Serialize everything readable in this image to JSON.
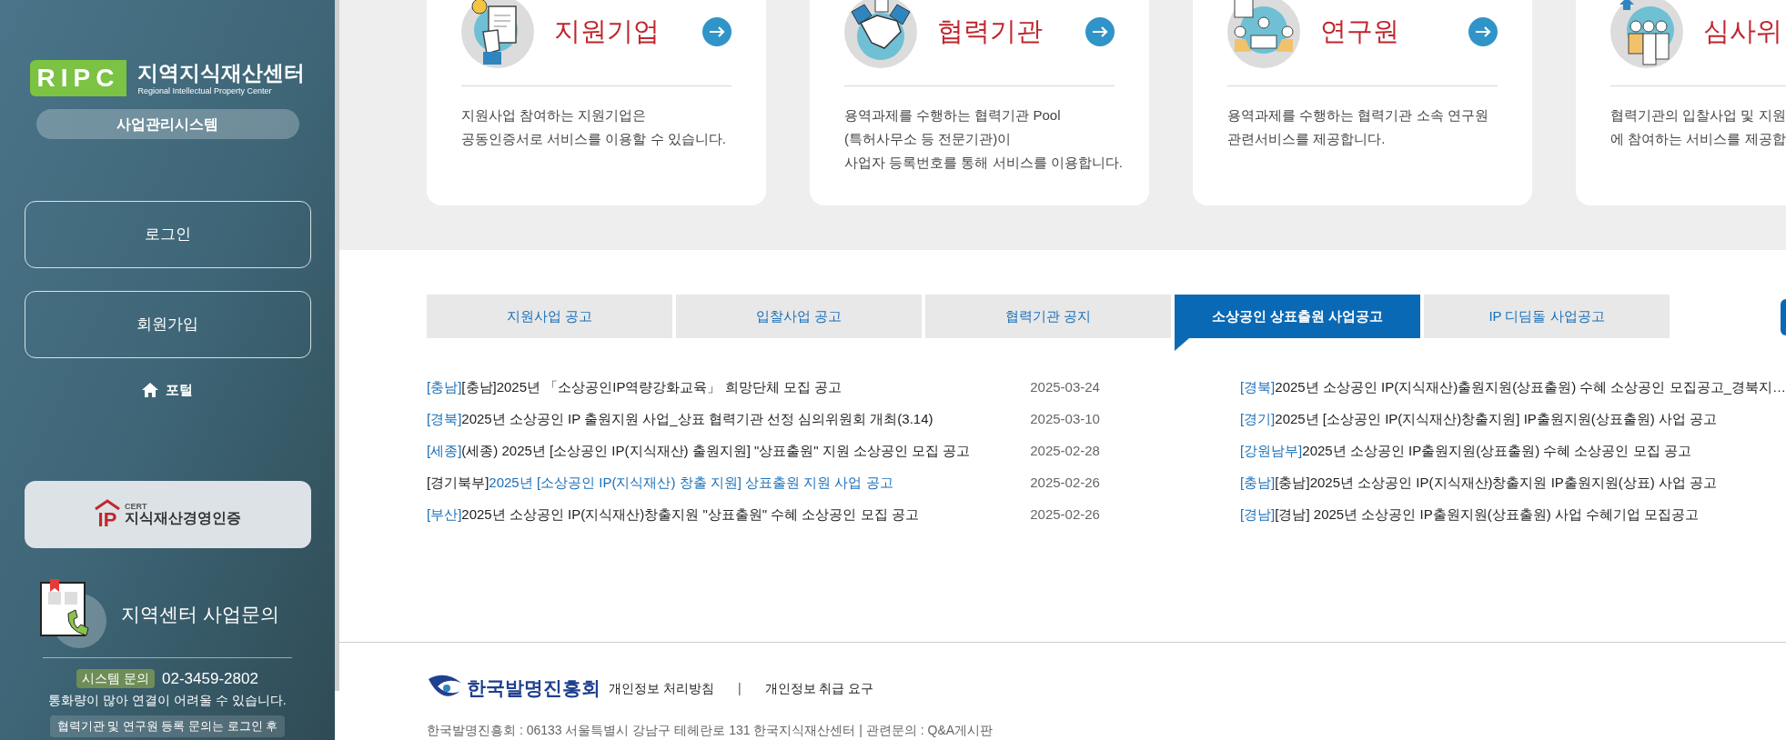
{
  "sidebar": {
    "logo": {
      "mark": "RIPC",
      "title": "지역지식재산센터",
      "subtitle": "Regional Intellectual Property Center"
    },
    "system_name": "사업관리시스템",
    "buttons": [
      "로그인",
      "회원가입"
    ],
    "portal_link": "포털",
    "cert_banner": {
      "mark": "IP",
      "small": "CERT",
      "text": "지식재산경영인증"
    },
    "inquiry": {
      "title": "지역센터 사업문의",
      "system_label": "시스템 문의",
      "phone": "02-3459-2802",
      "note": "통화량이 많아 연결이 어려울 수 있습니다.",
      "notice": "협력기관 및 연구원 등록 문의는 로그인 후"
    }
  },
  "cards": [
    {
      "kind": "document",
      "title": "지원기업",
      "has_arrow": true,
      "description": [
        "지원사업 참여하는 지원기업은",
        "공동인증서로 서비스를 이용할 수 있습니다."
      ]
    },
    {
      "kind": "handshake",
      "title": "협력기관",
      "has_arrow": true,
      "description": [
        "용역과제를 수행하는 협력기관 Pool",
        "(특허사무소 등 전문기관)이",
        "사업자 등록번호를 통해 서비스를 이용합니다."
      ]
    },
    {
      "kind": "meeting",
      "title": "연구원",
      "has_arrow": true,
      "description": [
        "용역과제를 수행하는 협력기관 소속 연구원",
        "관련서비스를 제공합니다."
      ]
    },
    {
      "kind": "people",
      "title": "심사위",
      "has_arrow": false,
      "description": [
        "협력기관의 입찰사업 및 지원",
        "에 참여하는 서비스를 제공합"
      ]
    }
  ],
  "tabs": [
    {
      "label": "지원사업 공고",
      "selected": false
    },
    {
      "label": "입찰사업 공고",
      "selected": false
    },
    {
      "label": "협력기관 공지",
      "selected": false
    },
    {
      "label": "소상공인 상표출원 사업공고",
      "selected": true
    },
    {
      "label": "IP 디딤돌 사업공고",
      "selected": false
    }
  ],
  "notices_left": [
    {
      "tag": "[충남]",
      "tag_highlight": true,
      "title": "[충남]2025년 「소상공인IP역량강화교육」 희망단체 모집 공고",
      "title_highlight": false,
      "date": "2025-03-24"
    },
    {
      "tag": "[경북]",
      "tag_highlight": true,
      "title": "2025년 소상공인 IP 출원지원 사업_상표 협력기관 선정 심의위원회 개최(3.14)",
      "title_highlight": false,
      "date": "2025-03-10"
    },
    {
      "tag": "[세종]",
      "tag_highlight": true,
      "title": "(세종) 2025년 [소상공인 IP(지식재산) 출원지원] \"상표출원\" 지원 소상공인 모집 공고",
      "title_highlight": false,
      "date": "2025-02-28"
    },
    {
      "tag": "[경기북부]",
      "tag_highlight": false,
      "title": "2025년 [소상공인 IP(지식재산) 창출 지원] 상표출원 지원 사업 공고",
      "title_highlight": true,
      "date": "2025-02-26"
    },
    {
      "tag": "[부산]",
      "tag_highlight": true,
      "title": "2025년 소상공인 IP(지식재산)창출지원 \"상표출원\" 수혜 소상공인 모집 공고",
      "title_highlight": false,
      "date": "2025-02-26"
    }
  ],
  "notices_right": [
    {
      "tag": "[경북]",
      "tag_highlight": true,
      "title": "2025년 소상공인 IP(지식재산)출원지원(상표출원) 수혜 소상공인 모집공고_경북지…",
      "title_highlight": false
    },
    {
      "tag": "[경기]",
      "tag_highlight": true,
      "title": "2025년 [소상공인 IP(지식재산)창출지원] IP출원지원(상표출원) 사업 공고",
      "title_highlight": false
    },
    {
      "tag": "[강원남부]",
      "tag_highlight": true,
      "title": "2025년 소상공인 IP출원지원(상표출원) 수혜 소상공인 모집 공고",
      "title_highlight": false
    },
    {
      "tag": "[충남]",
      "tag_highlight": true,
      "title": "[충남]2025년 소상공인 IP(지식재산)창출지원 IP출원지원(상표) 사업 공고",
      "title_highlight": false
    },
    {
      "tag": "[경남]",
      "tag_highlight": true,
      "title": "[경남] 2025년 소상공인 IP출원지원(상표출원) 사업 수혜기업 모집공고",
      "title_highlight": false
    }
  ],
  "footer": {
    "logo_text": "한국발명진흥회",
    "links": [
      "개인정보 처리방침",
      "개인정보 취급 요구"
    ],
    "separator": "|",
    "address": "한국발명진흥회 : 06133 서울특별시 강남구 테헤란로 131 한국지식재산센터 | 관련문의 : Q&A게시판"
  }
}
